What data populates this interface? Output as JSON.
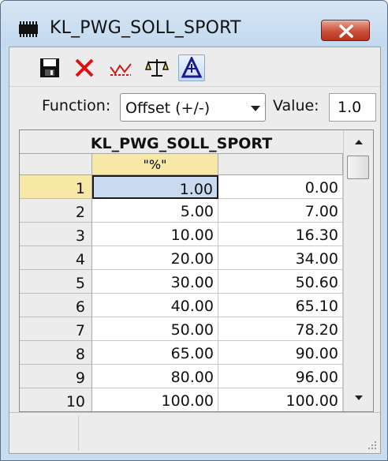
{
  "window": {
    "title": "KL_PWG_SOLL_SPORT"
  },
  "toolbar": {
    "buttons": [
      {
        "name": "save-icon"
      },
      {
        "name": "delete-icon"
      },
      {
        "name": "graph-icon"
      },
      {
        "name": "balance-icon"
      },
      {
        "name": "delta-icon"
      }
    ]
  },
  "function": {
    "label": "Function:",
    "selected": "Offset (+/-)",
    "value_label": "Value:",
    "value": "1.0"
  },
  "table": {
    "title": "KL_PWG_SOLL_SPORT",
    "unit": "\"%\"",
    "unit2": "",
    "rows": [
      {
        "idx": "1",
        "x": "1.00",
        "y": "0.00"
      },
      {
        "idx": "2",
        "x": "5.00",
        "y": "7.00"
      },
      {
        "idx": "3",
        "x": "10.00",
        "y": "16.30"
      },
      {
        "idx": "4",
        "x": "20.00",
        "y": "34.00"
      },
      {
        "idx": "5",
        "x": "30.00",
        "y": "50.60"
      },
      {
        "idx": "6",
        "x": "40.00",
        "y": "65.10"
      },
      {
        "idx": "7",
        "x": "50.00",
        "y": "78.20"
      },
      {
        "idx": "8",
        "x": "65.00",
        "y": "90.00"
      },
      {
        "idx": "9",
        "x": "80.00",
        "y": "96.00"
      },
      {
        "idx": "10",
        "x": "100.00",
        "y": "100.00"
      }
    ]
  },
  "colors": {
    "selection": "#c8d9f0",
    "header_highlight": "#f7e9a5",
    "close_button": "#c9503b"
  }
}
